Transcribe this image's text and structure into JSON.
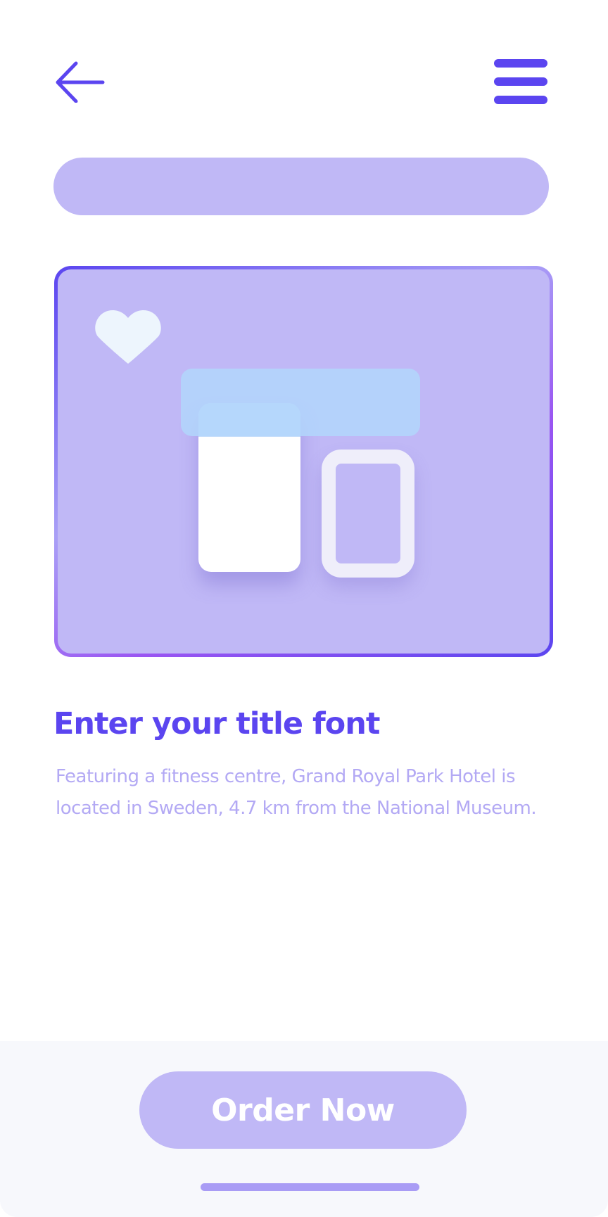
{
  "nav": {
    "back_icon": "arrow-left-icon",
    "menu_icon": "hamburger-menu-icon"
  },
  "search": {
    "placeholder": "",
    "value": ""
  },
  "card": {
    "favorite_icon": "heart-icon",
    "illustration": "layout-illustration"
  },
  "content": {
    "title": "Enter your title font",
    "description": "Featuring a fitness centre, Grand Royal Park Hotel is located in Sweden, 4.7 km from the National Museum."
  },
  "footer": {
    "order_label": "Order Now"
  },
  "colors": {
    "primary": "#5b45f0",
    "primary_light": "#c0b8f6",
    "text_muted": "#b3a9f4",
    "background": "#ffffff",
    "panel": "#f7f8fc"
  }
}
